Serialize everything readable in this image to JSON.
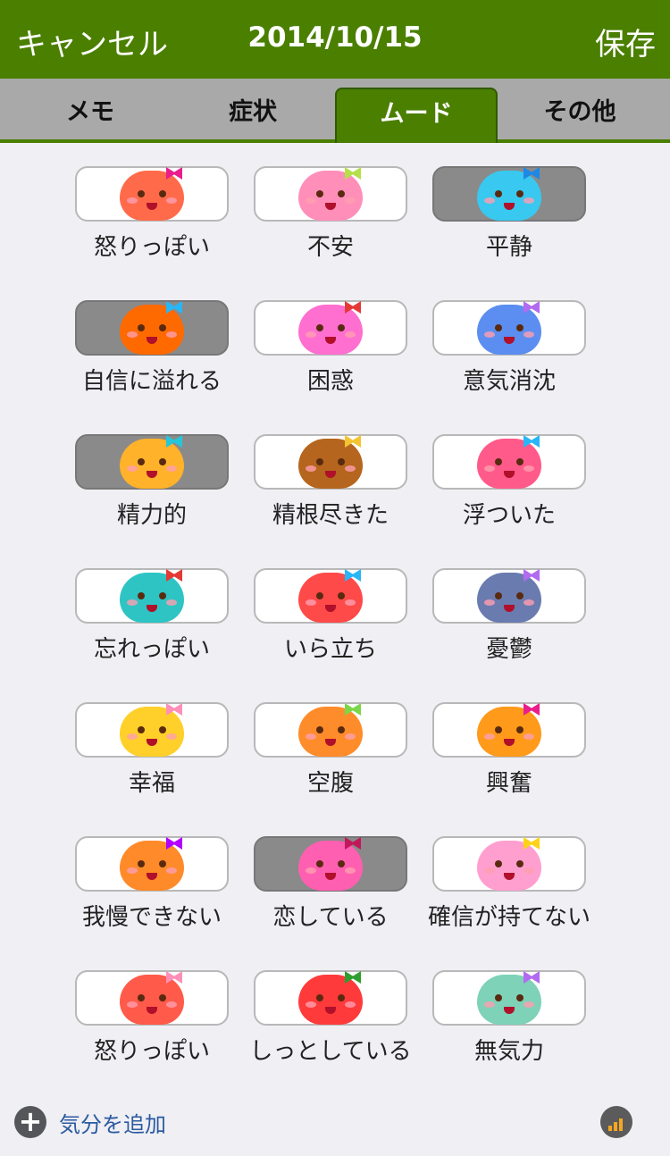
{
  "header": {
    "cancel_label": "キャンセル",
    "title": "2014/10/15",
    "save_label": "保存"
  },
  "tabs": [
    {
      "label": "メモ",
      "active": false
    },
    {
      "label": "症状",
      "active": false
    },
    {
      "label": "ムード",
      "active": true
    },
    {
      "label": "その他",
      "active": false
    }
  ],
  "moods": [
    {
      "label": "怒りっぽい",
      "selected": false,
      "face_color": "#ff6b4a",
      "bow_color": "#e91e8c"
    },
    {
      "label": "不安",
      "selected": false,
      "face_color": "#ff8fb8",
      "bow_color": "#b6e04a"
    },
    {
      "label": "平静",
      "selected": true,
      "face_color": "#38c8f0",
      "bow_color": "#1e88e5"
    },
    {
      "label": "自信に溢れる",
      "selected": true,
      "face_color": "#ff6a00",
      "bow_color": "#29b6f6"
    },
    {
      "label": "困惑",
      "selected": false,
      "face_color": "#ff6fd0",
      "bow_color": "#e53935"
    },
    {
      "label": "意気消沈",
      "selected": false,
      "face_color": "#5b8ef0",
      "bow_color": "#b26bf0"
    },
    {
      "label": "精力的",
      "selected": true,
      "face_color": "#ffb22a",
      "bow_color": "#26c6da"
    },
    {
      "label": "精根尽きた",
      "selected": false,
      "face_color": "#b5651d",
      "bow_color": "#f4c430"
    },
    {
      "label": "浮ついた",
      "selected": false,
      "face_color": "#ff5a8a",
      "bow_color": "#29b6f6"
    },
    {
      "label": "忘れっぽい",
      "selected": false,
      "face_color": "#2ec4c4",
      "bow_color": "#e53935"
    },
    {
      "label": "いら立ち",
      "selected": false,
      "face_color": "#ff4a4a",
      "bow_color": "#29b6f6"
    },
    {
      "label": "憂鬱",
      "selected": false,
      "face_color": "#6a7bb0",
      "bow_color": "#b26bf0"
    },
    {
      "label": "幸福",
      "selected": false,
      "face_color": "#ffcf2a",
      "bow_color": "#ff8fb8"
    },
    {
      "label": "空腹",
      "selected": false,
      "face_color": "#ff8c2a",
      "bow_color": "#7cd64a"
    },
    {
      "label": "興奮",
      "selected": false,
      "face_color": "#ff9a1a",
      "bow_color": "#e91e8c"
    },
    {
      "label": "我慢できない",
      "selected": false,
      "face_color": "#ff8a2a",
      "bow_color": "#b100ff"
    },
    {
      "label": "恋している",
      "selected": true,
      "face_color": "#ff5fb0",
      "bow_color": "#c2185b"
    },
    {
      "label": "確信が持てない",
      "selected": false,
      "face_color": "#ff9fcf",
      "bow_color": "#ffd21a"
    },
    {
      "label": "怒りっぽい",
      "selected": false,
      "face_color": "#ff5a4a",
      "bow_color": "#ff8fb8"
    },
    {
      "label": "しっとしている",
      "selected": false,
      "face_color": "#ff3a3a",
      "bow_color": "#2e9e2e"
    },
    {
      "label": "無気力",
      "selected": false,
      "face_color": "#7ed2b8",
      "bow_color": "#b26bf0"
    }
  ],
  "footer": {
    "add_mood_label": "気分を追加"
  },
  "icons": {
    "add": "plus-circle-icon",
    "stats": "bar-chart-icon"
  }
}
